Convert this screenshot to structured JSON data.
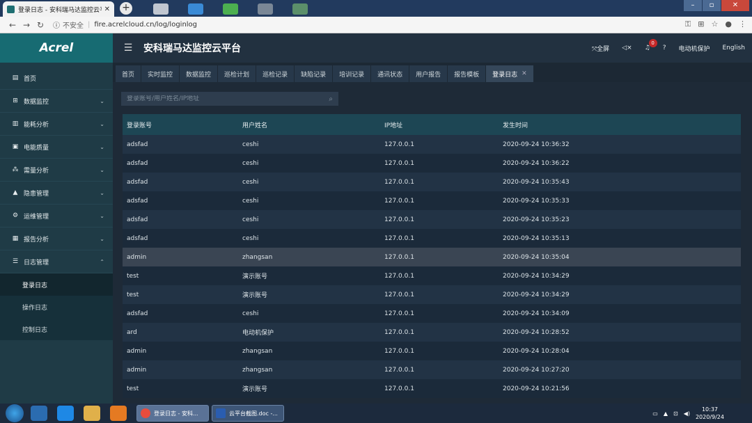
{
  "browser": {
    "tab_title": "登录日志 - 安科瑞马达监控云平",
    "url_secure": "不安全",
    "url": "fire.acrelcloud.cn/log/loginlog"
  },
  "app": {
    "logo": "Acrel",
    "title": "安科瑞马达监控云平台",
    "fullscreen": "全屏",
    "notification_count": "0",
    "user": "电动机保护",
    "language": "English"
  },
  "sidebar": {
    "items": [
      {
        "label": "首页",
        "icon": "home-icon"
      },
      {
        "label": "数据监控",
        "icon": "monitor-icon"
      },
      {
        "label": "能耗分析",
        "icon": "bar-chart-icon"
      },
      {
        "label": "电能质量",
        "icon": "calendar-icon"
      },
      {
        "label": "需量分析",
        "icon": "network-icon"
      },
      {
        "label": "隐患管理",
        "icon": "warning-icon"
      },
      {
        "label": "运维管理",
        "icon": "gear-icon"
      },
      {
        "label": "报告分析",
        "icon": "report-icon"
      },
      {
        "label": "日志管理",
        "icon": "log-icon"
      }
    ],
    "sub_items": [
      "登录日志",
      "操作日志",
      "控制日志"
    ]
  },
  "tabs": [
    "首页",
    "实时监控",
    "数据监控",
    "巡检计划",
    "巡检记录",
    "缺陷记录",
    "培训记录",
    "通讯状态",
    "用户报告",
    "报告模板",
    "登录日志"
  ],
  "search": {
    "placeholder": "登录账号/用户姓名/IP地址"
  },
  "table": {
    "headers": [
      "登录账号",
      "用户姓名",
      "IP地址",
      "发生时间"
    ],
    "rows": [
      [
        "adsfad",
        "ceshi",
        "127.0.0.1",
        "2020-09-24 10:36:32"
      ],
      [
        "adsfad",
        "ceshi",
        "127.0.0.1",
        "2020-09-24 10:36:22"
      ],
      [
        "adsfad",
        "ceshi",
        "127.0.0.1",
        "2020-09-24 10:35:43"
      ],
      [
        "adsfad",
        "ceshi",
        "127.0.0.1",
        "2020-09-24 10:35:33"
      ],
      [
        "adsfad",
        "ceshi",
        "127.0.0.1",
        "2020-09-24 10:35:23"
      ],
      [
        "adsfad",
        "ceshi",
        "127.0.0.1",
        "2020-09-24 10:35:13"
      ],
      [
        "admin",
        "zhangsan",
        "127.0.0.1",
        "2020-09-24 10:35:04"
      ],
      [
        "test",
        "演示账号",
        "127.0.0.1",
        "2020-09-24 10:34:29"
      ],
      [
        "test",
        "演示账号",
        "127.0.0.1",
        "2020-09-24 10:34:29"
      ],
      [
        "adsfad",
        "ceshi",
        "127.0.0.1",
        "2020-09-24 10:34:09"
      ],
      [
        "ard",
        "电动机保护",
        "127.0.0.1",
        "2020-09-24 10:28:52"
      ],
      [
        "admin",
        "zhangsan",
        "127.0.0.1",
        "2020-09-24 10:28:04"
      ],
      [
        "admin",
        "zhangsan",
        "127.0.0.1",
        "2020-09-24 10:27:20"
      ],
      [
        "test",
        "演示账号",
        "127.0.0.1",
        "2020-09-24 10:21:56"
      ]
    ]
  },
  "taskbar": {
    "task1": "登录日志 - 安科...",
    "task2": "云平台截图.doc -...",
    "time": "10:37",
    "date": "2020/9/24"
  }
}
